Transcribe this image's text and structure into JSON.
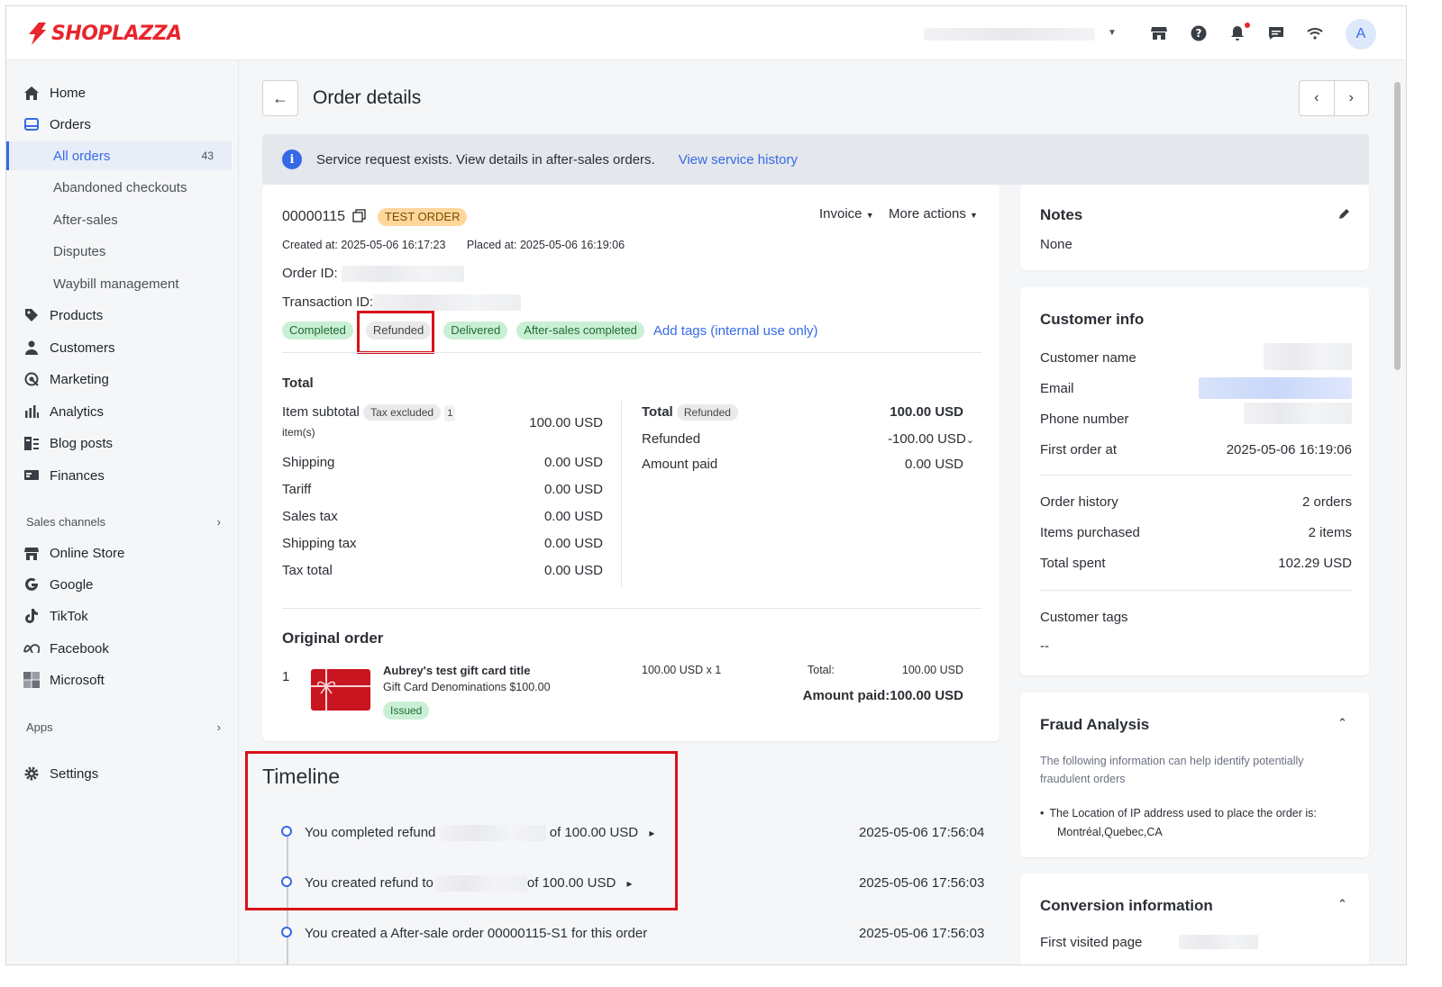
{
  "brand": {
    "name": "SHOPLAZZA",
    "color": "#e8262d"
  },
  "topbar": {
    "avatar_letter": "A",
    "icons": [
      "store-icon",
      "help-icon",
      "bell-icon",
      "chat-icon",
      "wifi-icon"
    ]
  },
  "sidebar": {
    "items": [
      {
        "label": "Home",
        "icon": "home-icon"
      },
      {
        "label": "Orders",
        "icon": "orders-icon"
      },
      {
        "label": "Products",
        "icon": "tag-icon"
      },
      {
        "label": "Customers",
        "icon": "person-icon"
      },
      {
        "label": "Marketing",
        "icon": "marketing-icon"
      },
      {
        "label": "Analytics",
        "icon": "chart-icon"
      },
      {
        "label": "Blog posts",
        "icon": "blog-icon"
      },
      {
        "label": "Finances",
        "icon": "finance-icon"
      }
    ],
    "order_subitems": [
      {
        "label": "All orders",
        "count": "43"
      },
      {
        "label": "Abandoned checkouts"
      },
      {
        "label": "After-sales"
      },
      {
        "label": "Disputes"
      },
      {
        "label": "Waybill management"
      }
    ],
    "sales_channels_label": "Sales channels",
    "channels": [
      {
        "label": "Online Store"
      },
      {
        "label": "Google"
      },
      {
        "label": "TikTok"
      },
      {
        "label": "Facebook"
      },
      {
        "label": "Microsoft"
      }
    ],
    "apps_label": "Apps",
    "settings_label": "Settings"
  },
  "header": {
    "title": "Order details"
  },
  "banner": {
    "text": "Service request exists. View details in after-sales orders.",
    "link": "View service history"
  },
  "order": {
    "number": "00000115",
    "test_badge": "TEST ORDER",
    "invoice_label": "Invoice",
    "more_actions_label": "More actions",
    "created_label": "Created at:",
    "created_value": "2025-05-06 16:17:23",
    "placed_label": "Placed at:",
    "placed_value": "2025-05-06 16:19:06",
    "order_id_label": "Order ID:",
    "transaction_id_label": "Transaction ID:",
    "tags": [
      "Completed",
      "Refunded",
      "Delivered",
      "After-sales completed"
    ],
    "add_tags_label": "Add tags (internal use only)"
  },
  "totals": {
    "title": "Total",
    "item_subtotal_label": "Item subtotal",
    "tax_excluded_badge": "Tax excluded",
    "item_count": "1",
    "items_unit": "item(s)",
    "item_subtotal_value": "100.00 USD",
    "rows": [
      {
        "label": "Shipping",
        "value": "0.00 USD"
      },
      {
        "label": "Tariff",
        "value": "0.00 USD"
      },
      {
        "label": "Sales tax",
        "value": "0.00 USD"
      },
      {
        "label": "Shipping tax",
        "value": "0.00 USD"
      },
      {
        "label": "Tax total",
        "value": "0.00 USD"
      }
    ],
    "total_label": "Total",
    "refunded_badge": "Refunded",
    "total_value": "100.00 USD",
    "refunded_label": "Refunded",
    "refunded_value": "-100.00 USD",
    "amount_paid_label": "Amount paid",
    "amount_paid_value": "0.00 USD"
  },
  "original_order": {
    "title": "Original order",
    "index": "1",
    "product_title": "Aubrey's test gift card title",
    "variant": "Gift Card Denominations $100.00",
    "status_badge": "Issued",
    "price_qty": "100.00 USD x 1",
    "total_label": "Total:",
    "total_value": "100.00 USD",
    "amount_paid": "Amount paid:100.00 USD"
  },
  "timeline": {
    "title": "Timeline",
    "events": [
      {
        "prefix": "You completed refund",
        "suffix": "of 100.00 USD",
        "time": "2025-05-06 17:56:04"
      },
      {
        "prefix": "You created refund to",
        "suffix": "of 100.00 USD",
        "time": "2025-05-06 17:56:03"
      },
      {
        "prefix": "You created a After-sale order 00000115-S1 for this order",
        "suffix": "",
        "time": "2025-05-06 17:56:03"
      }
    ]
  },
  "notes": {
    "title": "Notes",
    "value": "None"
  },
  "customer": {
    "title": "Customer info",
    "name_label": "Customer name",
    "email_label": "Email",
    "phone_label": "Phone number",
    "first_order_label": "First order at",
    "first_order_value": "2025-05-06 16:19:06",
    "order_history_label": "Order history",
    "order_history_value": "2 orders",
    "items_purchased_label": "Items purchased",
    "items_purchased_value": "2 items",
    "total_spent_label": "Total spent",
    "total_spent_value": "102.29 USD",
    "tags_label": "Customer tags",
    "tags_value": "--"
  },
  "fraud": {
    "title": "Fraud Analysis",
    "description": "The following information can help identify potentially fraudulent orders",
    "bullet_line1": "The Location of IP address used to place the order is:",
    "bullet_line2": "Montréal,Quebec,CA"
  },
  "conversion": {
    "title": "Conversion information",
    "first_visited_label": "First visited page"
  }
}
